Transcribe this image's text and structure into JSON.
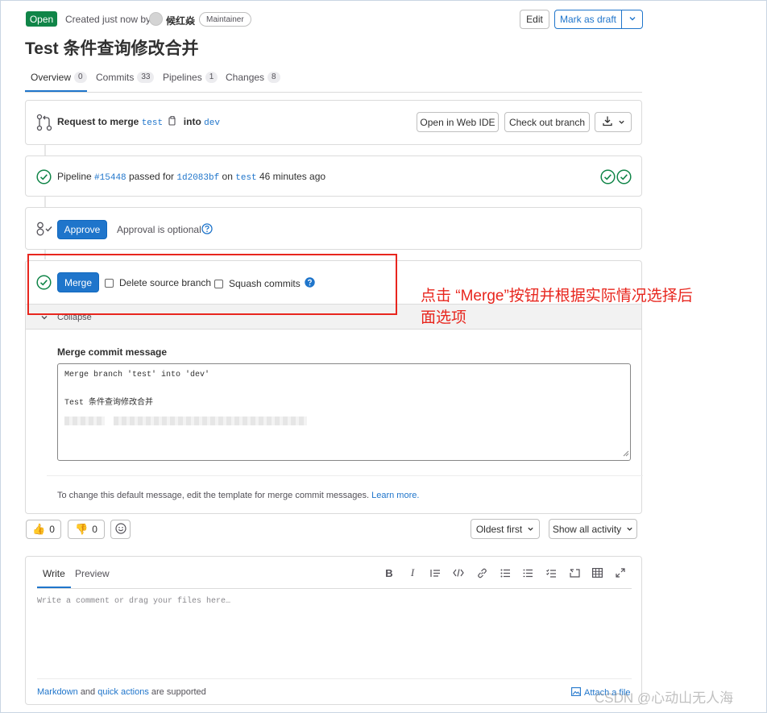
{
  "header": {
    "status_badge": "Open",
    "created_text": "Created just now by",
    "author": "候红焱",
    "role": "Maintainer",
    "edit_label": "Edit",
    "draft_label": "Mark as draft",
    "title": "Test 条件查询修改合并"
  },
  "tabs": [
    {
      "label": "Overview",
      "count": "0"
    },
    {
      "label": "Commits",
      "count": "33"
    },
    {
      "label": "Pipelines",
      "count": "1"
    },
    {
      "label": "Changes",
      "count": "8"
    }
  ],
  "request": {
    "prefix": "Request to merge",
    "source": "test",
    "into": "into",
    "target": "dev",
    "web_ide_label": "Open in Web IDE",
    "checkout_label": "Check out branch"
  },
  "pipeline": {
    "prefix": "Pipeline",
    "id": "#15448",
    "passed_for": "passed for",
    "commit": "1d2083bf",
    "on": "on",
    "branch": "test",
    "time": "46 minutes ago"
  },
  "approval": {
    "approve_label": "Approve",
    "optional_text": "Approval is optional"
  },
  "merge": {
    "merge_label": "Merge",
    "delete_branch_label": "Delete source branch",
    "squash_label": "Squash commits",
    "collapse_label": "Collapse",
    "commit_msg_label": "Merge commit message",
    "commit_msg_line1": "Merge branch 'test' into 'dev'",
    "commit_msg_line2": "Test 条件查询修改合并",
    "hint_text": "To change this default message, edit the template for merge commit messages.",
    "learn_more": "Learn more."
  },
  "annotation": {
    "line1": "点击 “Merge”按钮并根据实际情况选择后",
    "line2": "面选项"
  },
  "reactions": {
    "thumbs_up": "0",
    "thumbs_down": "0",
    "sort_label": "Oldest first",
    "filter_label": "Show all activity"
  },
  "comment": {
    "write_tab": "Write",
    "preview_tab": "Preview",
    "placeholder": "Write a comment or drag your files here…",
    "markdown_link": "Markdown",
    "and_text": "and",
    "quick_actions_link": "quick actions",
    "supported_text": "are supported",
    "attach_label": "Attach a file"
  },
  "watermark": "CSDN @心动山无人海",
  "colors": {
    "accent": "#1f75cb",
    "success": "#108548",
    "annotation_red": "#e8261e"
  }
}
